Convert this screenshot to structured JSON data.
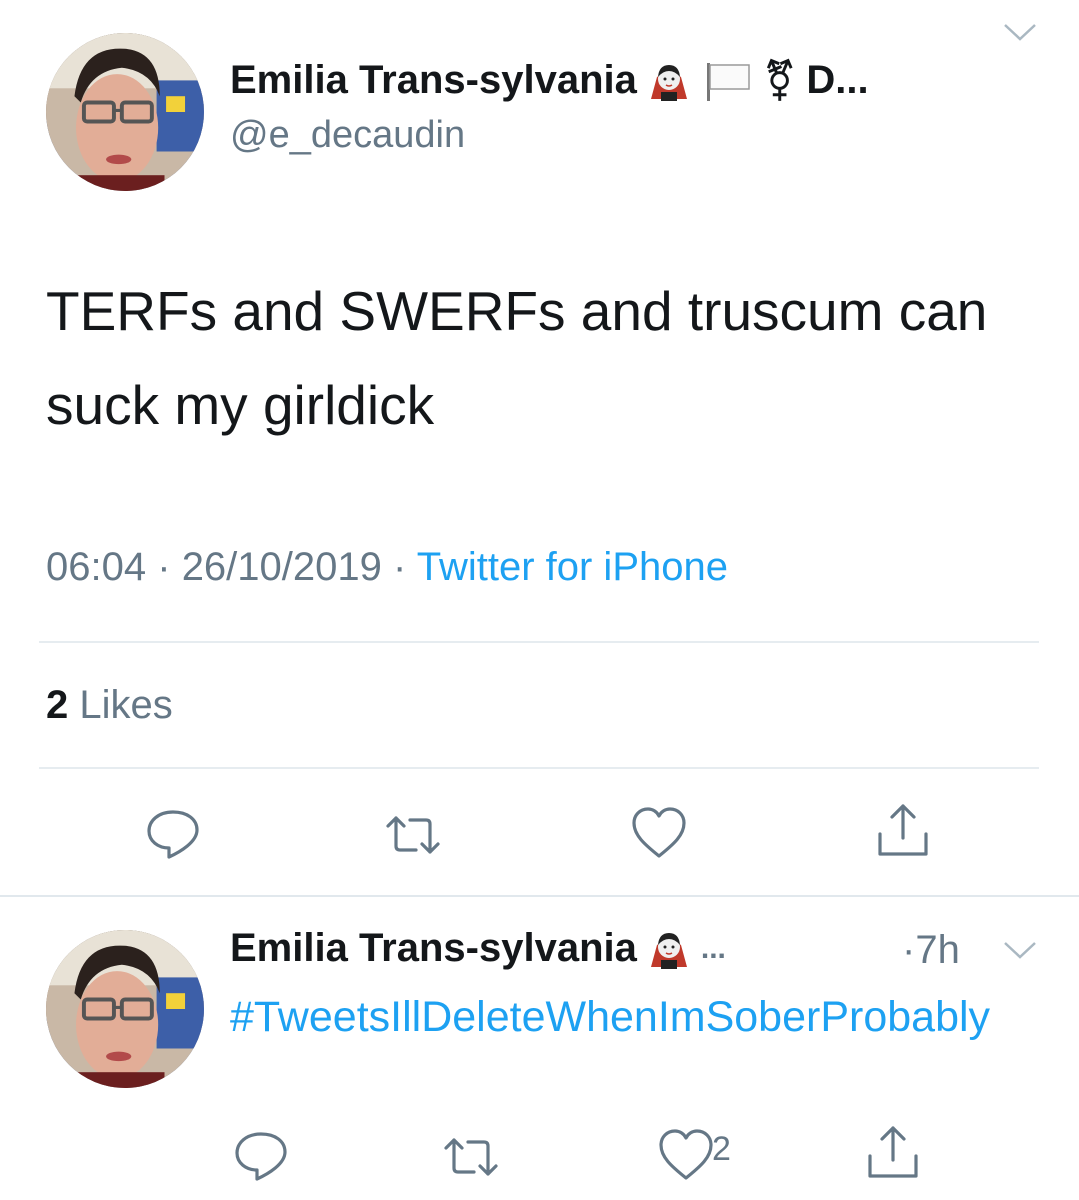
{
  "main_tweet": {
    "display_name": "Emilia Trans-sylvania",
    "name_truncation": "D...",
    "trans_symbol": "⚧",
    "handle": "@e_decaudin",
    "text": "TERFs and SWERFs and truscum can suck my girldick",
    "time": "06:04",
    "date": "26/10/2019",
    "separator": "·",
    "source": "Twitter for iPhone",
    "likes_count": "2",
    "likes_label": "Likes",
    "icons": [
      "vampire-emoji-icon",
      "white-flag-emoji-icon",
      "transgender-symbol-icon",
      "chevron-down-icon",
      "reply-icon",
      "retweet-icon",
      "like-icon",
      "share-icon"
    ]
  },
  "reply_tweet": {
    "display_name": "Emilia Trans-sylvania",
    "ellipsis": "...",
    "time": "·7h",
    "hashtag": "#TweetsIllDeleteWhenImSoberProbably",
    "like_count": "2"
  },
  "colors": {
    "text_primary": "#14171a",
    "text_secondary": "#657786",
    "link": "#1da1f2",
    "divider": "#e6ecf0"
  }
}
